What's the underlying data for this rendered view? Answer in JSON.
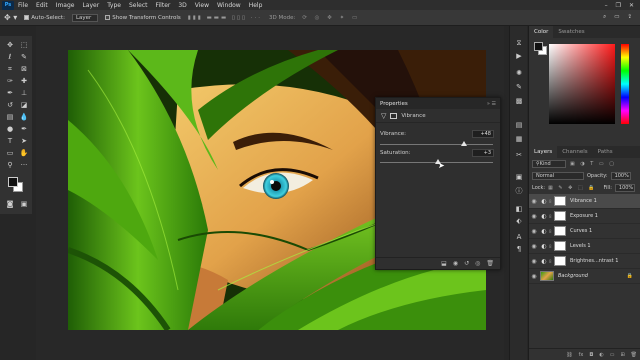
{
  "menubar": {
    "logo": "Ps",
    "items": [
      "File",
      "Edit",
      "Image",
      "Layer",
      "Type",
      "Select",
      "Filter",
      "3D",
      "View",
      "Window",
      "Help"
    ],
    "window_controls": [
      "–",
      "❐",
      "✕"
    ]
  },
  "options": {
    "auto_select_label": "Auto-Select:",
    "auto_select_value": "Layer",
    "show_transform_label": "Show Transform Controls",
    "mode_3d_label": "3D Mode:"
  },
  "properties": {
    "title": "Properties",
    "adjustment_name": "Vibrance",
    "vibrance_label": "Vibrance:",
    "vibrance_value": "+48",
    "vibrance_fraction": 0.74,
    "saturation_label": "Saturation:",
    "saturation_value": "+3",
    "saturation_fraction": 0.51
  },
  "color_panel": {
    "tabs": [
      "Color",
      "Swatches"
    ]
  },
  "layers_panel": {
    "tabs": [
      "Layers",
      "Channels",
      "Paths"
    ],
    "filter_kind": "Kind",
    "blend_mode": "Normal",
    "opacity_label": "Opacity:",
    "opacity_value": "100%",
    "lock_label": "Lock:",
    "fill_label": "Fill:",
    "fill_value": "100%",
    "layers": [
      "Vibrance 1",
      "Exposure 1",
      "Curves 1",
      "Levels 1",
      "Brightnes...ntrast 1",
      "Background"
    ]
  },
  "colors": {
    "accent": "#31a8ff",
    "leaf_green": "#3a9a12",
    "iris": "#2bb0c8"
  }
}
